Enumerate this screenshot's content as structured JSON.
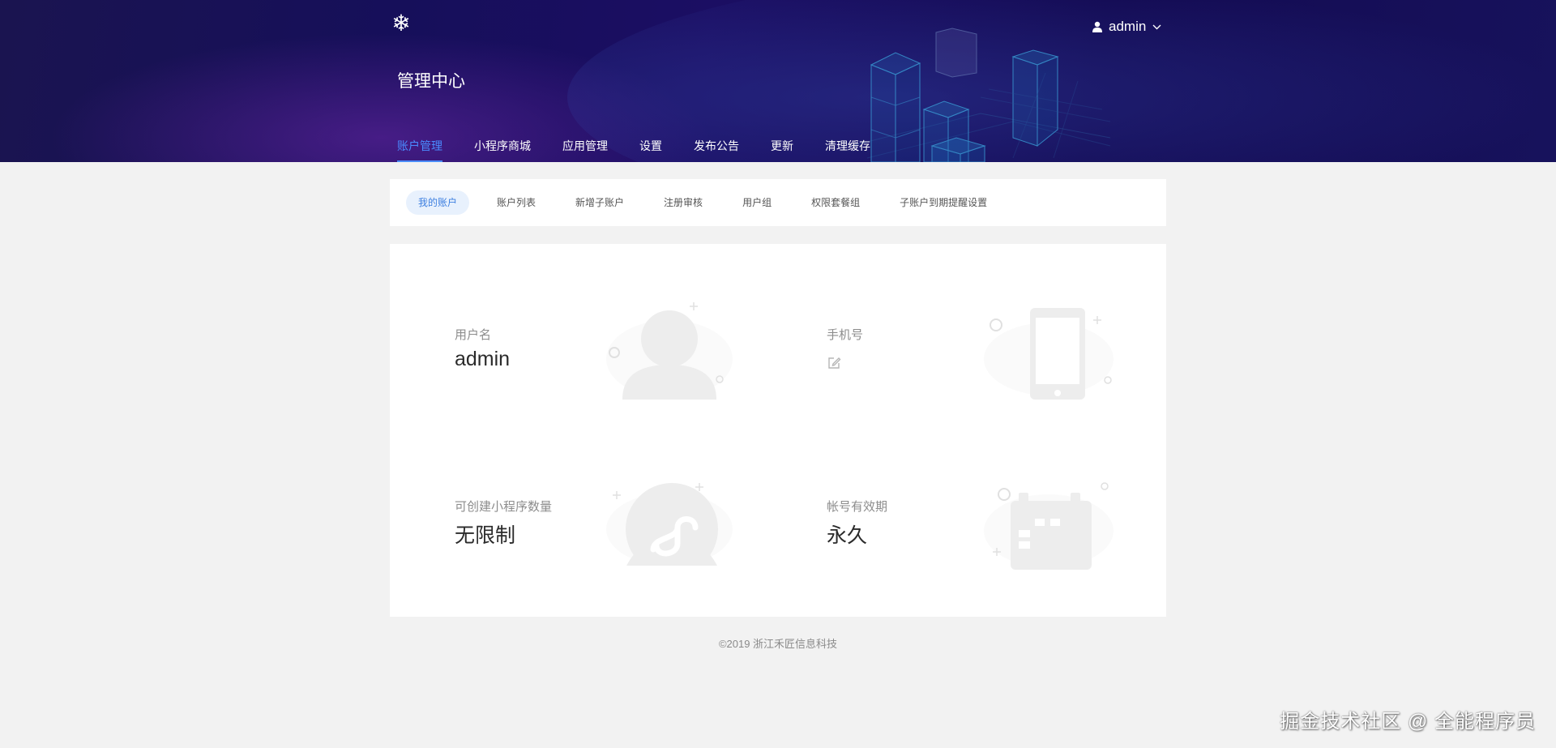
{
  "header": {
    "logo_icon": "snowflake-icon",
    "title": "管理中心",
    "user": {
      "name": "admin",
      "icon": "user-icon",
      "dropdown_icon": "chevron-down-icon"
    },
    "nav": [
      {
        "label": "账户管理",
        "active": true
      },
      {
        "label": "小程序商城",
        "active": false
      },
      {
        "label": "应用管理",
        "active": false
      },
      {
        "label": "设置",
        "active": false
      },
      {
        "label": "发布公告",
        "active": false
      },
      {
        "label": "更新",
        "active": false
      },
      {
        "label": "清理缓存",
        "active": false
      }
    ]
  },
  "subnav": {
    "tabs": [
      {
        "label": "我的账户",
        "active": true
      },
      {
        "label": "账户列表",
        "active": false
      },
      {
        "label": "新增子账户",
        "active": false
      },
      {
        "label": "注册审核",
        "active": false
      },
      {
        "label": "用户组",
        "active": false
      },
      {
        "label": "权限套餐组",
        "active": false
      },
      {
        "label": "子账户到期提醒设置",
        "active": false
      }
    ]
  },
  "account": {
    "username": {
      "label": "用户名",
      "value": "admin"
    },
    "phone": {
      "label": "手机号",
      "value": ""
    },
    "app_quota": {
      "label": "可创建小程序数量",
      "value": "无限制"
    },
    "validity": {
      "label": "帐号有效期",
      "value": "永久"
    }
  },
  "footer": {
    "copyright": "©2019 浙江禾匠信息科技"
  },
  "watermark": "掘金技术社区 @ 全能程序员",
  "colors": {
    "accent": "#4a8cff",
    "header_bg": "#160f5a",
    "page_bg": "#f2f2f2"
  }
}
